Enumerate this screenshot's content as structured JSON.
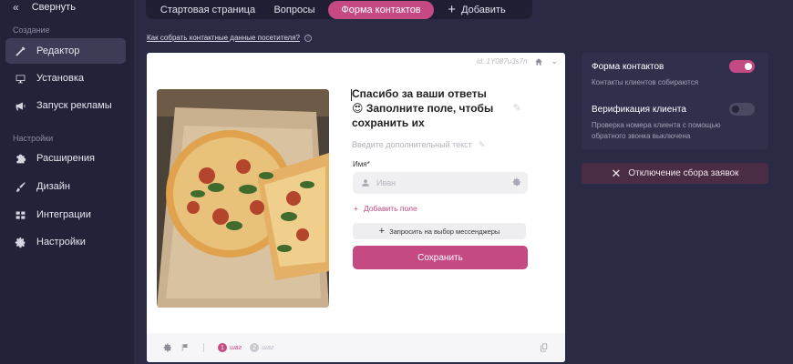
{
  "sidebar": {
    "collapse_label": "Свернуть",
    "section_create": "Создание",
    "section_settings": "Настройки",
    "items": [
      {
        "label": "Редактор",
        "icon": "pencil-icon",
        "active": true
      },
      {
        "label": "Установка",
        "icon": "install-icon",
        "active": false
      },
      {
        "label": "Запуск рекламы",
        "icon": "megaphone-icon",
        "active": false
      },
      {
        "label": "Расширения",
        "icon": "puzzle-icon",
        "active": false
      },
      {
        "label": "Дизайн",
        "icon": "brush-icon",
        "active": false
      },
      {
        "label": "Интеграции",
        "icon": "integrations-icon",
        "active": false
      },
      {
        "label": "Настройки",
        "icon": "gear-icon",
        "active": false
      }
    ]
  },
  "tabs": {
    "start": "Стартовая страница",
    "questions": "Вопросы",
    "contact_form": "Форма контактов",
    "add": "Добавить"
  },
  "help_link": "Как собрать контактные данные посетителя?",
  "preview": {
    "id_label": "id: 1Y087u3s7n",
    "title": "Спасибо за ваши ответы 😍 Заполните поле, чтобы сохранить их",
    "subtext_placeholder": "Введите дополнительный текст",
    "name_label": "Имя*",
    "name_placeholder": "Иван",
    "add_field": "Добавить поле",
    "messengers_button": "Запросить на выбор мессенджеры",
    "save_button": "Сохранить",
    "steps": [
      {
        "number": "1",
        "label": "шаг",
        "active": true
      },
      {
        "number": "2",
        "label": "шаг",
        "active": false
      }
    ]
  },
  "settings_panel": {
    "contact_form_title": "Форма контактов",
    "contact_form_desc": "Контакты клиентов собираются",
    "contact_form_enabled": true,
    "verification_title": "Верификация клиента",
    "verification_desc": "Проверка номера клиента с помощью обратного звонка выключена",
    "verification_enabled": false
  },
  "disable_button": "Отключение сбора заявок",
  "colors": {
    "accent": "#c54a84",
    "sidebar_bg": "#232239",
    "main_bg": "#2a2a45",
    "panel_bg": "#30304c"
  }
}
